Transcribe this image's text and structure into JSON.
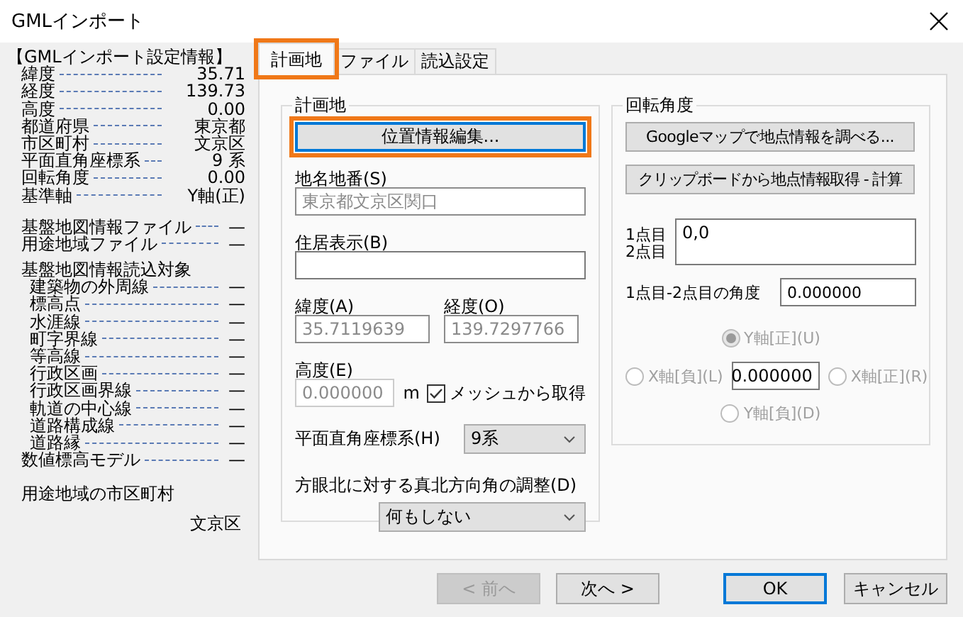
{
  "window": {
    "title": "GMLインポート"
  },
  "summary": {
    "title": "【GMLインポート設定情報】",
    "settings": [
      {
        "label": "緯度",
        "value": "35.71"
      },
      {
        "label": "経度",
        "value": "139.73"
      },
      {
        "label": "高度",
        "value": "0.00"
      },
      {
        "label": "都道府県",
        "value": "東京都"
      },
      {
        "label": "市区町村",
        "value": "文京区"
      },
      {
        "label": "平面直角座標系",
        "value": "9 系"
      },
      {
        "label": "回転角度",
        "value": "0.00"
      },
      {
        "label": "基準軸",
        "value": "Y軸(正)"
      }
    ],
    "files": [
      {
        "label": "基盤地図情報ファイル",
        "value": "—"
      },
      {
        "label": "用途地域ファイル",
        "value": "—"
      }
    ],
    "targets_title": "基盤地図情報読込対象",
    "targets": [
      {
        "label": "建築物の外周線",
        "value": "—",
        "indented": true
      },
      {
        "label": "標高点",
        "value": "—",
        "indented": true
      },
      {
        "label": "水涯線",
        "value": "—",
        "indented": true
      },
      {
        "label": "町字界線",
        "value": "—",
        "indented": true
      },
      {
        "label": "等高線",
        "value": "—",
        "indented": true
      },
      {
        "label": "行政区画",
        "value": "—",
        "indented": true
      },
      {
        "label": "行政区画界線",
        "value": "—",
        "indented": true
      },
      {
        "label": "軌道の中心線",
        "value": "—",
        "indented": true
      },
      {
        "label": "道路構成線",
        "value": "—",
        "indented": true
      },
      {
        "label": "道路縁",
        "value": "—",
        "indented": true
      },
      {
        "label": "数値標高モデル",
        "value": "—",
        "indented": false
      }
    ],
    "zoning_label": "用途地域の市区町村",
    "zoning_value": "文京区"
  },
  "tabs": [
    {
      "label": "計画地",
      "selected": true,
      "highlighted": true
    },
    {
      "label": "ファイル",
      "selected": false,
      "highlighted": false
    },
    {
      "label": "読込設定",
      "selected": false,
      "highlighted": false
    }
  ],
  "site": {
    "title": "計画地",
    "edit_button": {
      "label": "位置情報編集...",
      "focused": true,
      "highlighted": true
    },
    "address": {
      "label": "地名地番(S)",
      "value": "東京都文京区関口",
      "disabled": true
    },
    "residence": {
      "label": "住居表示(B)",
      "disabled": false
    },
    "latitude": {
      "label": "緯度(A)",
      "value": "35.7119639",
      "disabled": true
    },
    "longitude": {
      "label": "経度(O)",
      "value": "139.7297766",
      "disabled": true
    },
    "elevation": {
      "label": "高度(E)",
      "value": "0.000000",
      "disabled": true,
      "unit": "m"
    },
    "mesh": {
      "label": "メッシュから取得",
      "checked": true
    },
    "plane": {
      "label": "平面直角座標系(H)",
      "value": "9系"
    },
    "north": {
      "label": "方眼北に対する真北方向角の調整(D)",
      "value": "何もしない"
    }
  },
  "rotation": {
    "title": "回転角度",
    "buttons": [
      "Googleマップで地点情報を調べる...",
      "クリップボードから地点情報取得 - 計算"
    ],
    "point_labels": [
      "1点目",
      "2点目"
    ],
    "points": "0,0",
    "angle_label": "1点目-2点目の角度",
    "angle": "0.000000",
    "axis_value": "0.000000",
    "axes": [
      {
        "label": "Y軸[正](U)",
        "selected": true,
        "disabled": true
      },
      {
        "label": "X軸[負](L)",
        "selected": false,
        "disabled": true
      },
      {
        "label": "X軸[正](R)",
        "selected": false,
        "disabled": true
      },
      {
        "label": "Y軸[負](D)",
        "selected": false,
        "disabled": true
      }
    ]
  },
  "footer": [
    {
      "label": "< 前へ",
      "disabled": true,
      "default": false
    },
    {
      "label": "次へ >",
      "disabled": false,
      "default": false
    },
    {
      "label": "OK",
      "disabled": false,
      "default": true
    },
    {
      "label": "キャンセル",
      "disabled": false,
      "default": false
    }
  ]
}
